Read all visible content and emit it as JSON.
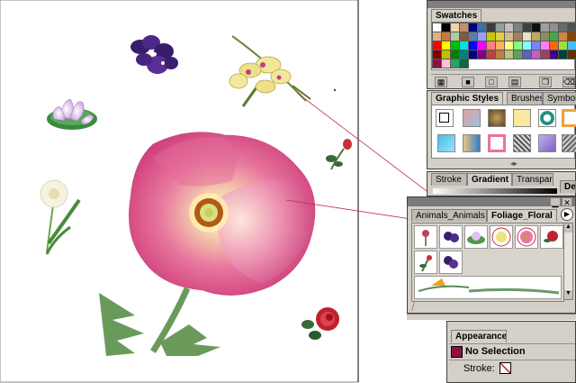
{
  "swatches_panel": {
    "tab": "Swatches",
    "colors": [
      [
        "#ffffff",
        "#000000",
        "#f2d5a8",
        "#c09070",
        "#000080",
        "#3a6ea5",
        "#3c3c3c",
        "#90a0a0",
        "#c0c0c0",
        "#808080",
        "#404040",
        "#101010",
        "#a0a0a0",
        "#909090",
        "#6a6a6a",
        "#505050"
      ],
      [
        "#e0b080",
        "#c87840",
        "#a8d0a0",
        "#7c5c3c",
        "#5c7cac",
        "#9c9cfc",
        "#c8c800",
        "#e0d040",
        "#d0c090",
        "#a08060",
        "#e8e0c8",
        "#c0a860",
        "#8c8c5c",
        "#44aa44",
        "#cc8844",
        "#884400"
      ],
      [
        "#ff0000",
        "#ffff00",
        "#00c000",
        "#00e0e0",
        "#0000ff",
        "#ff00ff",
        "#ff8080",
        "#ffb060",
        "#ffff80",
        "#80ff80",
        "#80ffff",
        "#8080ff",
        "#ff80ff",
        "#ff6600",
        "#a0e040",
        "#40c0ff"
      ],
      [
        "#800000",
        "#c0c000",
        "#008000",
        "#008080",
        "#000080",
        "#800080",
        "#c04040",
        "#c08040",
        "#c0c080",
        "#60a060",
        "#6060c0",
        "#c060c0",
        "#a04060",
        "#400080",
        "#004040",
        "#603000"
      ],
      [
        "#8c1040",
        "#ffc0e0",
        "#30a060",
        "#106840"
      ]
    ]
  },
  "graphic_styles_panel": {
    "tabs": [
      "Graphic Styles",
      "Brushes",
      "Symbols"
    ]
  },
  "gradient_panel": {
    "tabs": [
      "Stroke",
      "Gradient",
      "Transparency"
    ]
  },
  "symbols_panel": {
    "tabs": [
      "Animals_Animals",
      "Foliage_Floral"
    ],
    "side_tab": "Dec"
  },
  "appearance_panel": {
    "tab": "Appearance",
    "selection": "No Selection",
    "stroke_label": "Stroke:"
  }
}
